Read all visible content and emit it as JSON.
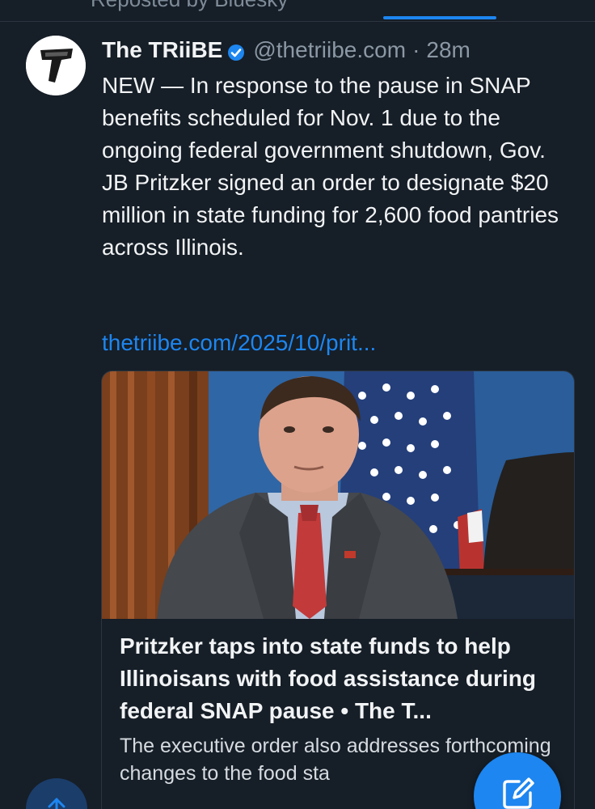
{
  "header": {
    "repost_text": "Reposted by Bluesky"
  },
  "post": {
    "display_name": "The TRiiBE",
    "handle": "@thetriibe.com",
    "separator": "·",
    "time": "28m",
    "text": "NEW — In response to the pause in SNAP benefits scheduled for Nov. 1 due to the ongoing federal government shutdown, Gov. JB Pritzker signed an order to designate $20 million in state funding for 2,600 food pantries across Illinois.",
    "link_text": "thetriibe.com/2025/10/prit..."
  },
  "card": {
    "title": "Pritzker taps into state funds to help Illinoisans with food assistance during federal SNAP pause • The T...",
    "description": "The executive order also addresses forthcoming changes to the food sta"
  },
  "icons": {
    "avatar": "thetriibe-logo-icon",
    "verified": "verified-badge-icon",
    "scroll_top": "arrow-up-icon",
    "compose": "compose-pencil-icon"
  },
  "colors": {
    "background": "#161e27",
    "accent": "#1d86f0",
    "muted": "#8b98a5",
    "text": "#f1f3f5"
  }
}
